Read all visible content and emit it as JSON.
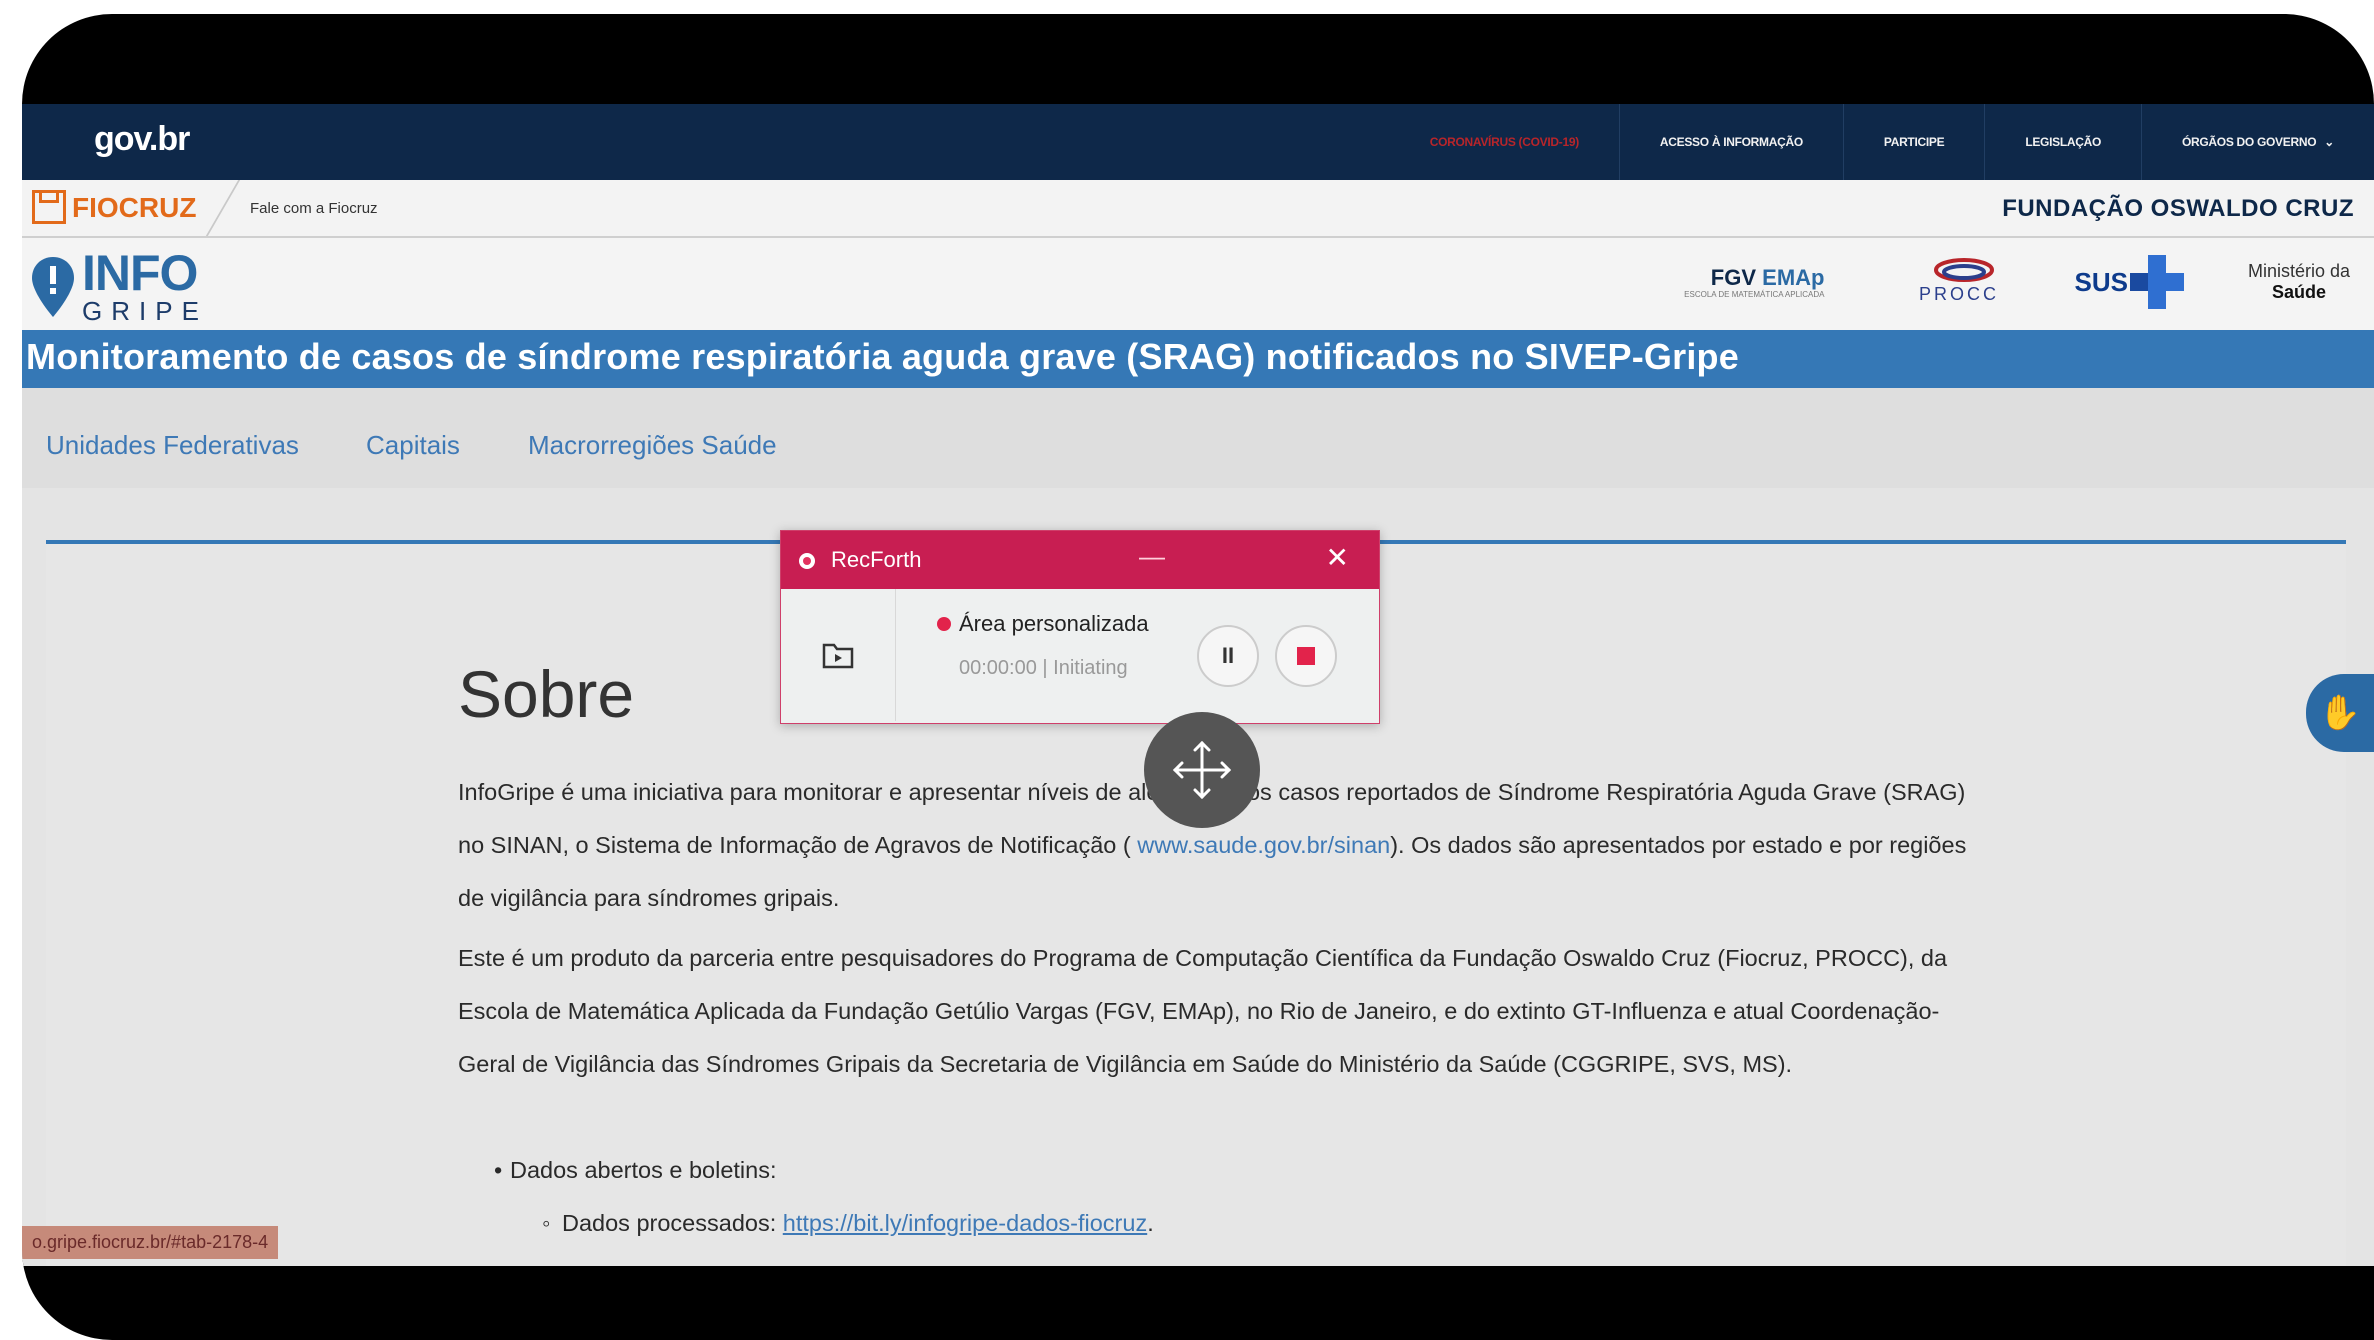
{
  "govbar": {
    "logo": "gov.br",
    "links": [
      "CORONAVÍRUS (COVID-19)",
      "ACESSO À INFORMAÇÃO",
      "PARTICIPE",
      "LEGISLAÇÃO",
      "ÓRGÃOS DO GOVERNO"
    ]
  },
  "fiocruz": {
    "logo": "FIOCRUZ",
    "contact": "Fale com a Fiocruz",
    "fundacao": "FUNDAÇÃO OSWALDO CRUZ"
  },
  "header": {
    "logo_top": "INFO",
    "logo_bottom": "GRIPE",
    "fgv": "FGV",
    "emap": "EMAp",
    "emap_sub": "ESCOLA DE MATEMÁTICA APLICADA",
    "procc": "PROCC",
    "sus": "SUS",
    "ministerio_1": "Ministério da",
    "ministerio_2": "Saúde"
  },
  "title": "Monitoramento de casos de síndrome respiratória aguda grave (SRAG) notificados no SIVEP-Gripe",
  "tabs": [
    "Unidades Federativas",
    "Capitais",
    "Macrorregiões Saúde"
  ],
  "article": {
    "heading": "Sobre",
    "p1_a": "InfoGripe é uma iniciativa para monitorar e apresentar níveis de alerta para os casos reportados de Síndrome Respiratória Aguda Grave (SRAG) no SINAN, o Sistema de Informação de Agravos de Notificação ( ",
    "p1_link": "www.saude.gov.br/sinan",
    "p1_b": "). Os dados são apresentados por estado e por regiões de vigilância para síndromes gripais.",
    "p2": "Este é um produto da parceria entre pesquisadores do Programa de Computação Científica da Fundação Oswaldo Cruz (Fiocruz, PROCC), da Escola de Matemática Aplicada da Fundação Getúlio Vargas (FGV, EMAp), no Rio de Janeiro, e do extinto GT-Influenza e atual Coordenação-Geral de Vigilância das Síndromes Gripais da Secretaria de Vigilância em Saúde do Ministério da Saúde (CGGRIPE, SVS, MS).",
    "bullet1": "Dados abertos e boletins:",
    "bullet2_label": "Dados processados: ",
    "bullet2_link": "https://bit.ly/infogripe-dados-fiocruz",
    "bullet2_end": "."
  },
  "status_url": "o.gripe.fiocruz.br/#tab-2178-4",
  "recforth": {
    "title": "RecForth",
    "minimize": "—",
    "close": "✕",
    "mode": "Área personalizada",
    "time": "00:00:00",
    "state": "Initiating",
    "pause": "II"
  }
}
